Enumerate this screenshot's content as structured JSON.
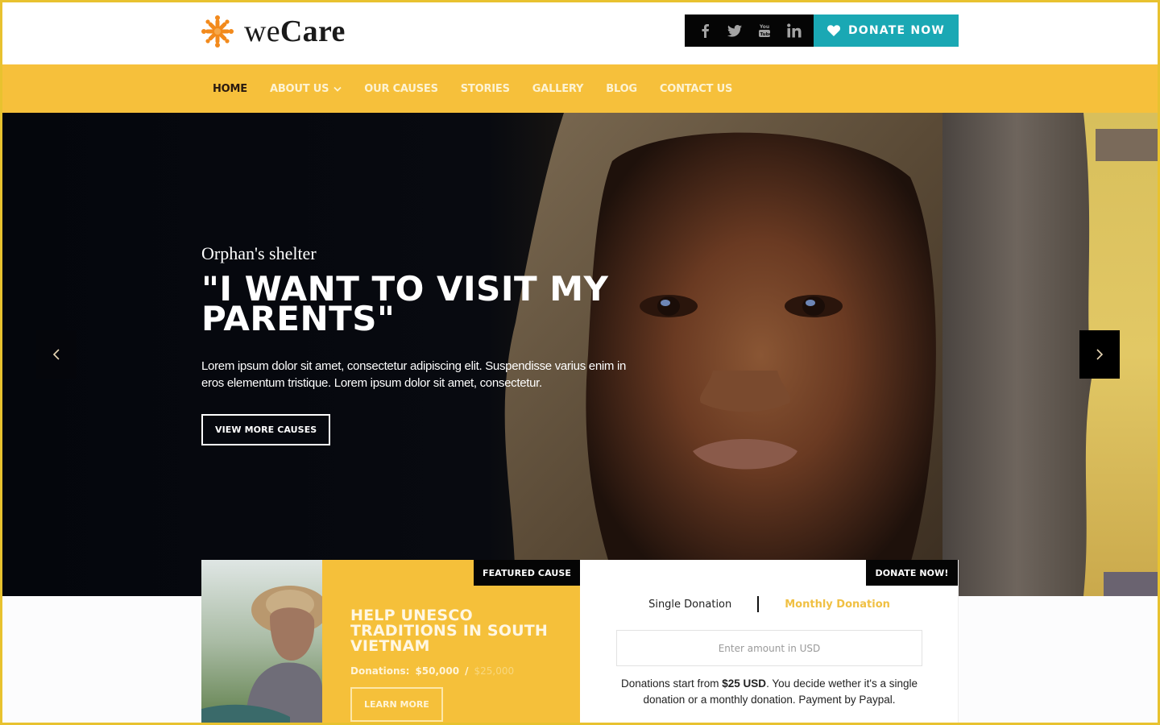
{
  "brand": {
    "name_light": "we",
    "name_bold": "Care",
    "logo_icon": "snowflake-star-icon",
    "accent_color": "#f6c03b",
    "logo_color": "#f28a1c"
  },
  "topbar": {
    "socials": [
      {
        "name": "facebook",
        "icon": "facebook-icon"
      },
      {
        "name": "twitter",
        "icon": "twitter-icon"
      },
      {
        "name": "youtube",
        "icon": "youtube-icon"
      },
      {
        "name": "linkedin",
        "icon": "linkedin-icon"
      }
    ],
    "donate_label": "DONATE NOW",
    "donate_icon": "heart-icon",
    "donate_color": "#1aa8b4"
  },
  "nav": {
    "items": [
      {
        "label": "HOME",
        "active": true
      },
      {
        "label": "ABOUT US",
        "dropdown": true
      },
      {
        "label": "OUR CAUSES"
      },
      {
        "label": "STORIES"
      },
      {
        "label": "GALLERY"
      },
      {
        "label": "BLOG"
      },
      {
        "label": "CONTACT US"
      }
    ]
  },
  "hero": {
    "eyebrow": "Orphan's shelter",
    "title": "\"I WANT TO VISIT MY PARENTS\"",
    "text": "Lorem ipsum dolor sit amet, consectetur adipiscing elit. Suspendisse varius enim in eros elementum tristique. Lorem ipsum dolor sit amet, consectetur.",
    "button": "VIEW MORE CAUSES",
    "prev_icon": "chevron-left-icon",
    "next_icon": "chevron-right-icon"
  },
  "featured": {
    "tag": "FEATURED CAUSE",
    "title": "HELP UNESCO TRADITIONS IN SOUTH VIETNAM",
    "donations_label": "Donations:",
    "raised": "$50,000",
    "separator": "/",
    "goal": "$25,000",
    "button": "LEARN MORE"
  },
  "donation": {
    "tag": "DONATE NOW!",
    "tabs": [
      "Single Donation",
      "Monthly Donation"
    ],
    "active_tab": "Monthly Donation",
    "amount_placeholder": "Enter amount in USD",
    "amount_value": "",
    "note_prefix": "Donations start from ",
    "note_amount": "$25 USD",
    "note_suffix": ". You decide wether it's a single donation or a monthly donation. Payment by Paypal."
  }
}
